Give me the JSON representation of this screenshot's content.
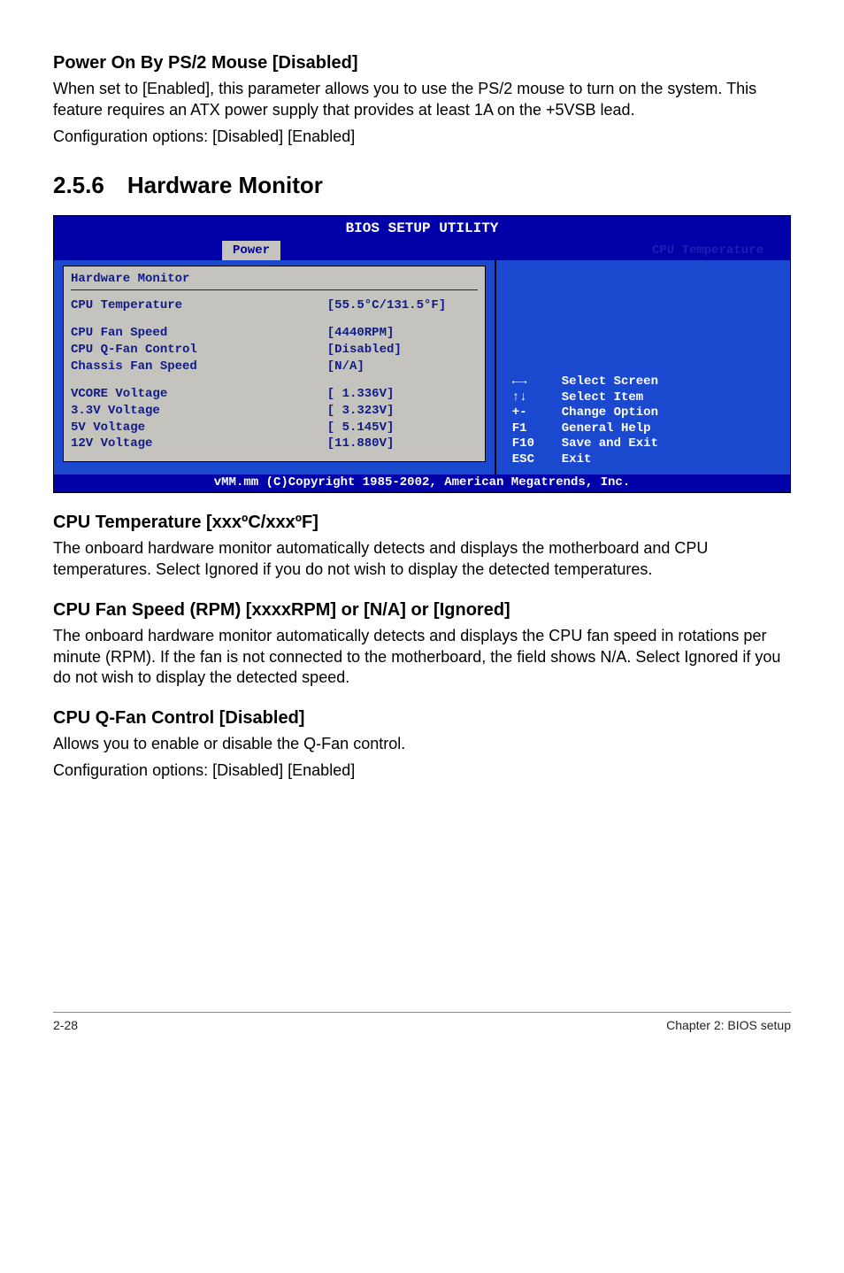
{
  "section_power_on": {
    "heading": "Power On By PS/2 Mouse [Disabled]",
    "para1": "When set to [Enabled], this parameter allows you to use the PS/2 mouse to turn on the system. This feature requires an ATX power supply that provides at least 1A on the +5VSB lead.",
    "para2": "Configuration options: [Disabled] [Enabled]"
  },
  "section_hw_monitor_heading": "2.5.6 Hardware Monitor",
  "bios": {
    "title": "BIOS SETUP UTILITY",
    "tab_active": "Power",
    "tab_right_hint": "CPU Temperature",
    "panel_title": "Hardware Monitor",
    "rows_group1": [
      {
        "label": "CPU Temperature",
        "value": "[55.5°C/131.5°F]"
      }
    ],
    "rows_group2": [
      {
        "label": "CPU Fan Speed",
        "value": "[4440RPM]"
      },
      {
        "label": "CPU Q-Fan Control",
        "value": "[Disabled]"
      },
      {
        "label": "Chassis Fan Speed",
        "value": "[N/A]"
      }
    ],
    "rows_group3": [
      {
        "label": "VCORE Voltage",
        "value": "[ 1.336V]"
      },
      {
        "label": "3.3V Voltage",
        "value": "[ 3.323V]"
      },
      {
        "label": "5V Voltage",
        "value": "[ 5.145V]"
      },
      {
        "label": "12V Voltage",
        "value": "[11.880V]"
      }
    ],
    "help": [
      {
        "key": "←→",
        "label": "Select Screen"
      },
      {
        "key": "↑↓",
        "label": "Select Item"
      },
      {
        "key": "+-",
        "label": "Change Option"
      },
      {
        "key": "F1",
        "label": "General Help"
      },
      {
        "key": "F10",
        "label": "Save and Exit"
      },
      {
        "key": "ESC",
        "label": "Exit"
      }
    ],
    "footer": "vMM.mm (C)Copyright 1985-2002, American Megatrends, Inc."
  },
  "section_cpu_temp": {
    "heading": "CPU Temperature [xxxºC/xxxºF]",
    "para": "The onboard hardware monitor automatically detects and displays the motherboard and CPU temperatures. Select Ignored if you do not wish to display the detected temperatures."
  },
  "section_fan_speed": {
    "heading": "CPU Fan Speed (RPM) [xxxxRPM] or [N/A] or [Ignored]",
    "para": "The onboard hardware monitor automatically detects and displays the CPU fan speed in rotations per minute (RPM). If the fan is not connected to the motherboard, the field shows N/A. Select Ignored if you do not wish to display the detected speed."
  },
  "section_qfan": {
    "heading": "CPU Q-Fan Control [Disabled]",
    "para1": "Allows you to enable or disable the Q-Fan control.",
    "para2": "Configuration options: [Disabled] [Enabled]"
  },
  "footer": {
    "left": "2-28",
    "right": "Chapter 2: BIOS setup"
  }
}
